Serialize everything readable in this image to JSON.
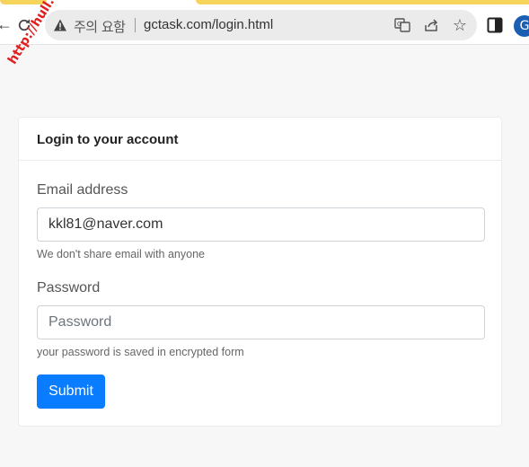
{
  "browser": {
    "security_warning": "주의 요함",
    "url": "gctask.com/login.html",
    "profile_initial": "G",
    "watermark": "http://hull.kr"
  },
  "login_card": {
    "title": "Login to your account",
    "email": {
      "label": "Email address",
      "value": "kkl81@naver.com",
      "placeholder": "",
      "help": "We don't share email with anyone"
    },
    "password": {
      "label": "Password",
      "value": "",
      "placeholder": "Password",
      "help": "your password is saved in encrypted form"
    },
    "submit_label": "Submit"
  },
  "colors": {
    "primary": "#0a7cff",
    "tab_accent": "#f6d35a",
    "watermark": "#e02020"
  }
}
